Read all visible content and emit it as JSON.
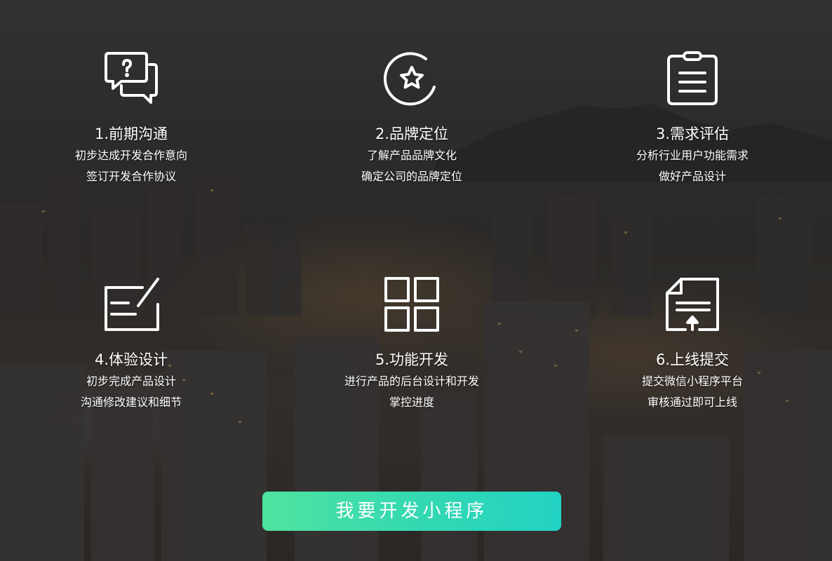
{
  "steps": [
    {
      "title": "1.前期沟通",
      "line1": "初步达成开发合作意向",
      "line2": "签订开发合作协议",
      "icon": "chat-question-icon"
    },
    {
      "title": "2.品牌定位",
      "line1": "了解产品品牌文化",
      "line2": "确定公司的品牌定位",
      "icon": "star-circle-icon"
    },
    {
      "title": "3.需求评估",
      "line1": "分析行业用户功能需求",
      "line2": "做好产品设计",
      "icon": "clipboard-icon"
    },
    {
      "title": "4.体验设计",
      "line1": "初步完成产品设计",
      "line2": "沟通修改建议和细节",
      "icon": "edit-pen-icon"
    },
    {
      "title": "5.功能开发",
      "line1": "进行产品的后台设计和开发",
      "line2": "掌控进度",
      "icon": "grid-icon"
    },
    {
      "title": "6.上线提交",
      "line1": "提交微信小程序平台",
      "line2": "审核通过即可上线",
      "icon": "document-upload-icon"
    }
  ],
  "cta": {
    "label": "我要开发小程序"
  },
  "colors": {
    "cta_start": "#4fe3a0",
    "cta_end": "#22d2c4",
    "text": "#ffffff"
  }
}
